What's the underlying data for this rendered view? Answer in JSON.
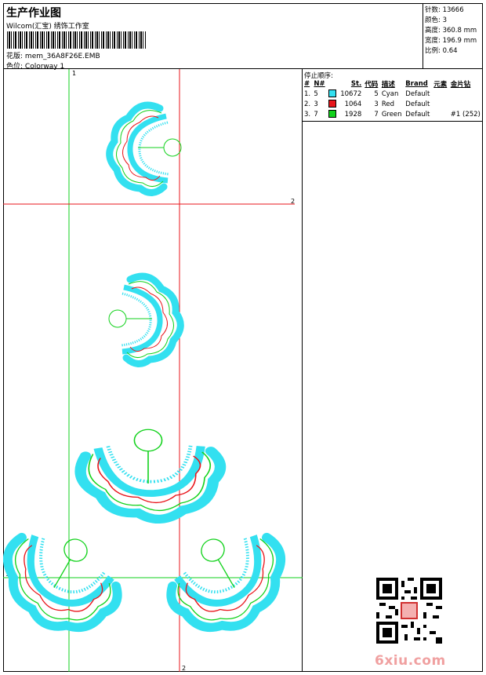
{
  "header": {
    "title": "生产作业图",
    "subtitle": "Wilcom(汇宝) 绣饰工作室",
    "design_label": "花版:",
    "design_value": "mem_36A8F26E.EMB",
    "colorway_label": "色位:",
    "colorway_value": "Colorway 1"
  },
  "stats": [
    {
      "label": "针数:",
      "value": "13666"
    },
    {
      "label": "颜色:",
      "value": "3"
    },
    {
      "label": "高度:",
      "value": "360.8 mm"
    },
    {
      "label": "宽度:",
      "value": "196.9 mm"
    },
    {
      "label": "比例:",
      "value": "0.64"
    }
  ],
  "canvas_markers": {
    "v1_top": "1",
    "h2_right": "2",
    "h1_left": "1",
    "v2_bottom": "2"
  },
  "panel": {
    "title": "停止顺序:",
    "columns": [
      "#",
      "N#",
      "St.",
      "代码",
      "描述",
      "Brand",
      "元素",
      "金片钻"
    ],
    "rows": [
      {
        "idx": "1.",
        "n": "5",
        "color": "#33e0f0",
        "st": "10672",
        "code": "5",
        "desc": "Cyan",
        "brand": "Default",
        "elem": "",
        "extra": ""
      },
      {
        "idx": "2.",
        "n": "3",
        "color": "#e8151b",
        "st": "1064",
        "code": "3",
        "desc": "Red",
        "brand": "Default",
        "elem": "",
        "extra": ""
      },
      {
        "idx": "3.",
        "n": "7",
        "color": "#12d21c",
        "st": "1928",
        "code": "7",
        "desc": "Green",
        "brand": "Default",
        "elem": "",
        "extra": "#1 (252)"
      }
    ]
  },
  "watermark": "6xiu.com",
  "colors": {
    "cyan": "#33e0f0",
    "red": "#e8151b",
    "green": "#12d21c"
  }
}
